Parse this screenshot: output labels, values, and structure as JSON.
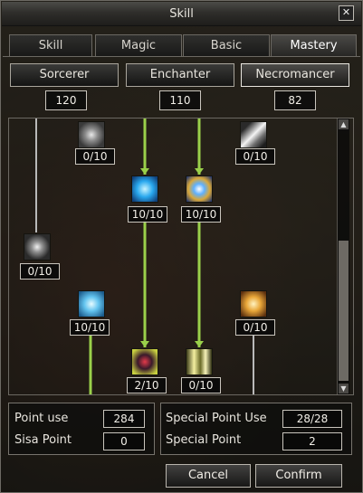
{
  "window": {
    "title": "Skill",
    "close_glyph": "✕"
  },
  "tabs": [
    {
      "label": "Skill",
      "active": false
    },
    {
      "label": "Magic",
      "active": false
    },
    {
      "label": "Basic",
      "active": false
    },
    {
      "label": "Mastery",
      "active": true
    }
  ],
  "schools": [
    {
      "label": "Sorcerer",
      "points": "120",
      "active": false
    },
    {
      "label": "Enchanter",
      "points": "110",
      "active": false
    },
    {
      "label": "Necromancer",
      "points": "82",
      "active": true
    }
  ],
  "skills": [
    {
      "name": "skill-grey-burst",
      "level": "0/10",
      "icon": "grey-burst-icon",
      "learned": false
    },
    {
      "name": "skill-white-slash",
      "level": "0/10",
      "icon": "white-slash-icon",
      "learned": false
    },
    {
      "name": "skill-blue-swirl",
      "level": "10/10",
      "icon": "blue-swirl-icon",
      "learned": true
    },
    {
      "name": "skill-shield-gold",
      "level": "10/10",
      "icon": "shield-gold-icon",
      "learned": true
    },
    {
      "name": "skill-snowflake",
      "level": "0/10",
      "icon": "snowflake-icon",
      "learned": false
    },
    {
      "name": "skill-ice-crystal",
      "level": "10/10",
      "icon": "ice-crystal-icon",
      "learned": true
    },
    {
      "name": "skill-flame-aura",
      "level": "0/10",
      "icon": "flame-aura-icon",
      "learned": false
    },
    {
      "name": "skill-dark-skull",
      "level": "2/10",
      "icon": "dark-skull-icon",
      "learned": true
    },
    {
      "name": "skill-light-beams",
      "level": "0/10",
      "icon": "light-beams-icon",
      "learned": false
    }
  ],
  "stats": {
    "point_use_label": "Point use",
    "point_use_value": "284",
    "sisa_point_label": "Sisa Point",
    "sisa_point_value": "0",
    "special_point_use_label": "Special Point Use",
    "special_point_use_value": "28/28",
    "special_point_label": "Special Point",
    "special_point_value": "2"
  },
  "buttons": {
    "cancel": "Cancel",
    "confirm": "Confirm"
  },
  "scrollbar": {
    "up_glyph": "▲",
    "down_glyph": "▼"
  },
  "colors": {
    "connector_active": "#9ad04a",
    "connector_inactive": "#b9b9b9"
  }
}
